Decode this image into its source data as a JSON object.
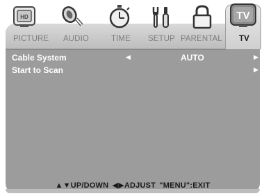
{
  "tabs": [
    {
      "label": "PICTURE",
      "icon": "picture-icon"
    },
    {
      "label": "AUDIO",
      "icon": "audio-icon"
    },
    {
      "label": "TIME",
      "icon": "timer-icon"
    },
    {
      "label": "SETUP",
      "icon": "tools-icon"
    },
    {
      "label": "PARENTAL",
      "icon": "lock-icon"
    },
    {
      "label": "TV",
      "icon": "tv-icon",
      "selected": true
    }
  ],
  "tv_icon_text": "TV",
  "menu": {
    "rows": [
      {
        "label": "Cable System",
        "value": "AUTO",
        "left_arrow": "◀",
        "right_arrow": "▶"
      },
      {
        "label": "Start to Scan",
        "value": "",
        "left_arrow": "",
        "right_arrow": "▶"
      }
    ]
  },
  "footer": {
    "updown": "▲▼UP/DOWN",
    "adjust": "◀▶ADJUST",
    "exit": "\"MENU\":EXIT"
  },
  "colors": {
    "panel_bg": "#9c9c9c",
    "header_bg": "#d0d0d0",
    "active_text": "#1a1a1a",
    "inactive_text": "#7d7d7d",
    "row_text": "#ffffff"
  }
}
